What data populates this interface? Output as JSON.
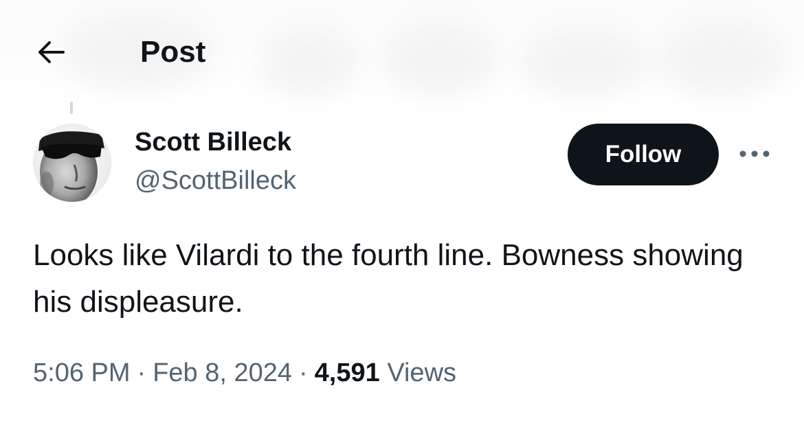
{
  "header": {
    "title": "Post",
    "back_icon": "arrow-left-icon"
  },
  "author": {
    "display_name": "Scott Billeck",
    "handle": "@ScottBilleck",
    "avatar_icon": "profile-photo"
  },
  "actions": {
    "follow_label": "Follow",
    "more_icon": "more-horizontal-icon"
  },
  "post": {
    "text": "Looks like Vilardi to the fourth line. Bowness showing his displeasure."
  },
  "meta": {
    "time": "5:06 PM",
    "separator": "·",
    "date": "Feb 8, 2024",
    "views_count": "4,591",
    "views_label": "Views"
  },
  "colors": {
    "text_primary": "#0f1419",
    "text_secondary": "#536471",
    "follow_bg": "#0f1419",
    "follow_text": "#ffffff",
    "thread_line": "#cfd9de"
  }
}
